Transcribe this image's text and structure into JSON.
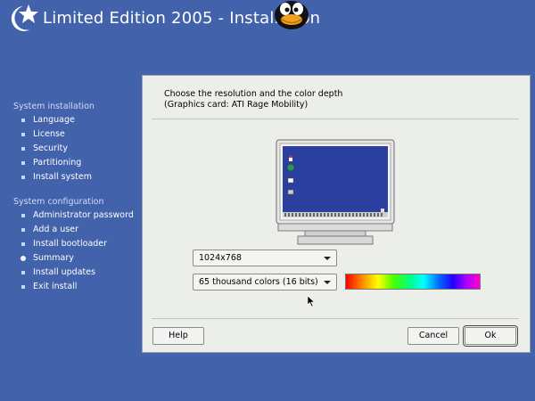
{
  "header": {
    "title": "Limited Edition 2005 - Installation"
  },
  "sidebar": {
    "install_heading": "System installation",
    "install_items": [
      {
        "label": "Language"
      },
      {
        "label": "License"
      },
      {
        "label": "Security"
      },
      {
        "label": "Partitioning"
      },
      {
        "label": "Install system"
      }
    ],
    "config_heading": "System configuration",
    "config_items": [
      {
        "label": "Administrator password"
      },
      {
        "label": "Add a user"
      },
      {
        "label": "Install bootloader"
      },
      {
        "label": "Summary",
        "current": true
      },
      {
        "label": "Install updates"
      },
      {
        "label": "Exit install"
      }
    ]
  },
  "dialog": {
    "heading_line1": "Choose the resolution and the color depth",
    "heading_line2": "(Graphics card: ATI Rage Mobility)",
    "resolution": "1024x768",
    "color_depth": "65 thousand colors (16 bits)",
    "help_label": "Help",
    "cancel_label": "Cancel",
    "ok_label": "Ok"
  },
  "icons": {
    "logo": "star-logo-icon",
    "mascot": "penguin-icon",
    "preview": "monitor-icon",
    "dropdown": "chevron-down-icon",
    "pointer": "mouse-cursor-icon"
  },
  "colors": {
    "background": "#4362ac",
    "dialog": "#eceeea",
    "monitor_screen": "#2a3f9e"
  }
}
